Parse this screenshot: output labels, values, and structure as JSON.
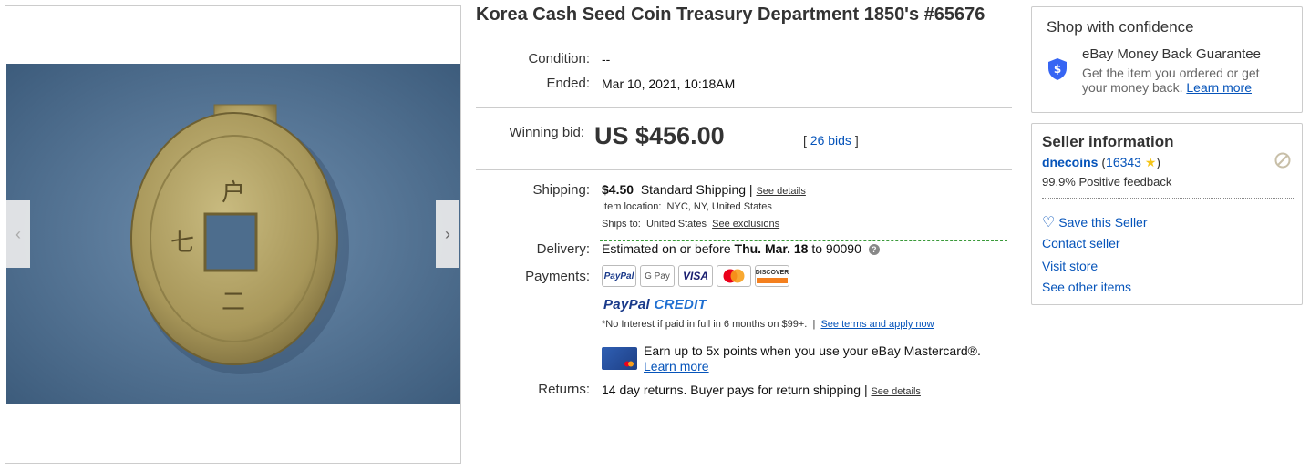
{
  "title": "Korea Cash Seed Coin Treasury Department 1850's #65676",
  "details": {
    "condition_label": "Condition:",
    "condition_value": "--",
    "ended_label": "Ended:",
    "ended_value": "Mar 10, 2021, 10:18AM"
  },
  "bid": {
    "label": "Winning bid:",
    "price": "US $456.00",
    "bids_open": "[",
    "bids_link": "26 bids",
    "bids_close": "]"
  },
  "shipping": {
    "label": "Shipping:",
    "cost": "$4.50",
    "method": "Standard Shipping",
    "sep": "|",
    "details_link": "See details",
    "location_label": "Item location:",
    "location_value": "NYC, NY, United States",
    "ships_to_label": "Ships to:",
    "ships_to_value": "United States",
    "exclusions_link": "See exclusions"
  },
  "delivery": {
    "label": "Delivery:",
    "text_prefix": "Estimated on or before",
    "date": "Thu. Mar. 18",
    "text_to": "to",
    "zip": "90090"
  },
  "payments": {
    "label": "Payments:",
    "logos": [
      "PayPal",
      "G Pay",
      "VISA",
      "Mastercard",
      "DISCOVER"
    ],
    "paypal_credit_a": "PayPal",
    "paypal_credit_b": "CREDIT",
    "credit_note": "*No Interest if paid in full in 6 months on $99+.",
    "credit_sep": "|",
    "credit_link": "See terms and apply now",
    "mastercard_text": "Earn up to 5x points when you use your eBay Mastercard®.",
    "mastercard_link": "Learn more"
  },
  "returns": {
    "label": "Returns:",
    "text": "14 day returns. Buyer pays for return shipping",
    "sep": "|",
    "details_link": "See details"
  },
  "shop_confidence": {
    "heading": "Shop with confidence",
    "guarantee_title": "eBay Money Back Guarantee",
    "guarantee_text": "Get the item you ordered or get your money back.",
    "learn_more": "Learn more"
  },
  "seller": {
    "heading": "Seller information",
    "name": "dnecoins",
    "score": "16343",
    "feedback": "99.9% Positive feedback",
    "save": "Save this Seller",
    "contact": "Contact seller",
    "visit": "Visit store",
    "other": "See other items"
  },
  "colors": {
    "link": "#0654ba",
    "delivery_dash": "#3a9a3a",
    "photo_bg": "#5a7a9a",
    "coin": "#b5a56a"
  },
  "icons": [
    "chevron-left-icon",
    "chevron-right-icon",
    "help-icon",
    "shield-dollar-icon",
    "star-icon",
    "no-entry-icon",
    "heart-icon"
  ]
}
